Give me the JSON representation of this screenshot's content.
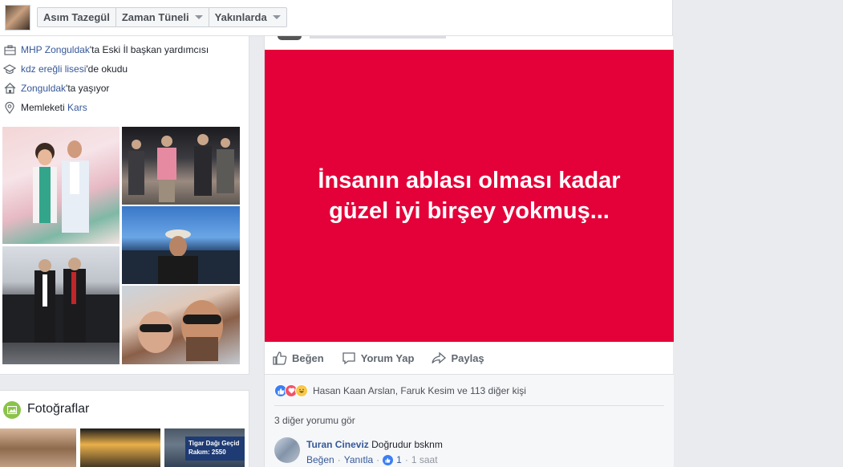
{
  "topbar": {
    "profile_name": "Asım Tazegül",
    "timeline": "Zaman Tüneli",
    "nearby": "Yakınlarda"
  },
  "intro": {
    "work": {
      "link": "MHP Zonguldak",
      "rest": "'ta Eski İl başkan yardımcısı"
    },
    "education": {
      "link": "kdz ereğli lisesi",
      "rest": "'de okudu"
    },
    "lives": {
      "link": "Zonguldak",
      "rest": "'ta yaşıyor"
    },
    "hometown": {
      "prefix": "Memleketi ",
      "link": "Kars"
    }
  },
  "photos": {
    "title": "Fotoğraflar",
    "sign_text": [
      "Tigar Dağı Geçid",
      "Rakım: 2550"
    ]
  },
  "post": {
    "text": "İnsanın ablası olması kadar güzel iyi birşey yokmuş...",
    "bg_color": "#e40038",
    "actions": {
      "like": "Beğen",
      "comment": "Yorum Yap",
      "share": "Paylaş"
    },
    "reactions_text": "Hasan Kaan Arslan, Faruk Kesim ve 113 diğer kişi",
    "more_comments": "3 diğer yorumu gör",
    "comment": {
      "author": "Turan Cineviz",
      "text": "Doğrudur bsknm",
      "like": "Beğen",
      "reply": "Yanıtla",
      "like_count": "1",
      "time": "1 saat"
    }
  }
}
